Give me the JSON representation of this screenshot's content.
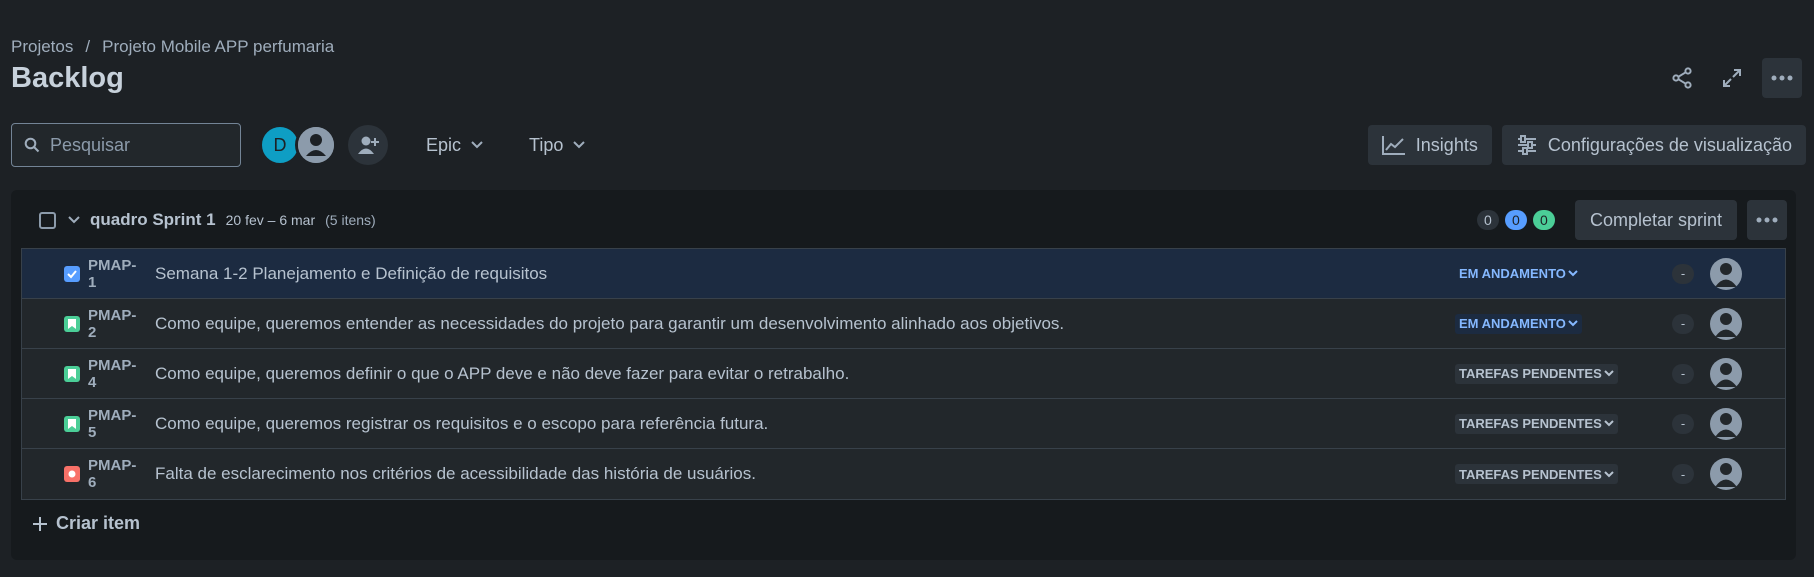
{
  "breadcrumb": {
    "root": "Projetos",
    "separator": "/",
    "project": "Projeto Mobile APP perfumaria"
  },
  "page": {
    "title": "Backlog"
  },
  "top_actions": {
    "icons": [
      "share-icon",
      "expand-icon",
      "more-icon"
    ]
  },
  "toolbar": {
    "search_placeholder": "Pesquisar",
    "avatar_initial": "D",
    "filters": [
      "Epic",
      "Tipo"
    ],
    "insights_label": "Insights",
    "view_settings_label": "Configurações de visualização"
  },
  "sprint": {
    "name": "quadro Sprint 1",
    "dates": "20 fev – 6 mar",
    "count": "(5 itens)",
    "points": {
      "todo": "0",
      "in_progress": "0",
      "done": "0"
    },
    "complete_label": "Completar sprint",
    "issues": [
      {
        "key": "PMAP-1",
        "type": "task",
        "summary": "Semana 1-2 Planejamento e Definição de requisitos",
        "status": "EM ANDAMENTO",
        "estimate": "-"
      },
      {
        "key": "PMAP-2",
        "type": "story",
        "summary": "Como equipe, queremos entender as necessidades do projeto para garantir um desenvolvimento alinhado aos objetivos.",
        "status": "EM ANDAMENTO",
        "estimate": "-"
      },
      {
        "key": "PMAP-4",
        "type": "story",
        "summary": "Como equipe, queremos definir o que o APP deve e não deve fazer para evitar o retrabalho.",
        "status": "TAREFAS PENDENTES",
        "estimate": "-"
      },
      {
        "key": "PMAP-5",
        "type": "story",
        "summary": "Como equipe, queremos registrar os requisitos e o escopo para referência futura.",
        "status": "TAREFAS PENDENTES",
        "estimate": "-"
      },
      {
        "key": "PMAP-6",
        "type": "bug",
        "summary": "Falta de esclarecimento nos critérios de acessibilidade das história de usuários.",
        "status": "TAREFAS PENDENTES",
        "estimate": "-"
      }
    ],
    "create_label": "Criar item"
  },
  "colors": {
    "background": "#1d2125",
    "panel": "#161a1d",
    "accent_blue": "#579dff",
    "green": "#4bce97",
    "red": "#f87168"
  }
}
